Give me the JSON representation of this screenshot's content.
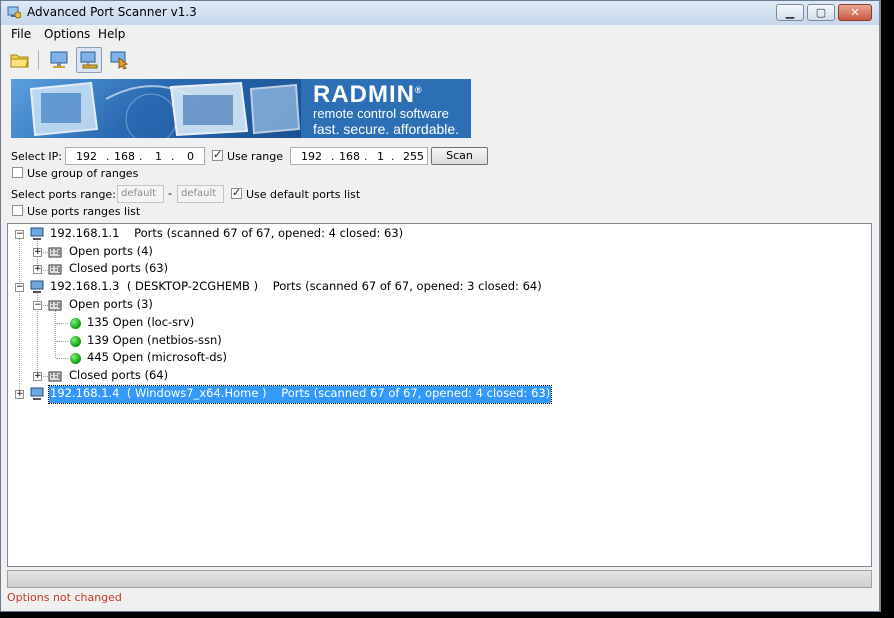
{
  "window": {
    "title": "Advanced Port Scanner v1.3"
  },
  "menu": {
    "items": [
      "File",
      "Options",
      "Help"
    ]
  },
  "banner": {
    "title": "RADMIN",
    "registered": "®",
    "line2": "remote control software",
    "line3": "fast. secure. affordable."
  },
  "ip_range": {
    "label": "Select IP:",
    "from": [
      "192",
      "168",
      "1",
      "0"
    ],
    "use_range_label": "Use range",
    "use_range_checked": true,
    "to": [
      "192",
      "168",
      "1",
      "255"
    ],
    "scan_label": "Scan"
  },
  "group": {
    "label": "Use group of ranges",
    "checked": false
  },
  "ports": {
    "label": "Select ports range:",
    "from_placeholder": "default",
    "separator": "-",
    "to_placeholder": "default",
    "use_default_label": "Use default ports list",
    "use_default_checked": true,
    "ranges_list_label": "Use ports ranges list",
    "ranges_list_checked": false
  },
  "tree": {
    "host1": {
      "ip": "192.168.1.1",
      "name": "",
      "summary": "Ports (scanned 67 of 67, opened: 4 closed: 63)",
      "open_label": "Open ports (4)",
      "closed_label": "Closed ports (63)"
    },
    "host2": {
      "ip": "192.168.1.3",
      "name": "( DESKTOP-2CGHEMB )",
      "summary": "Ports (scanned 67 of 67, opened: 3 closed: 64)",
      "open_label": "Open ports (3)",
      "open_ports": [
        "135 Open (loc-srv)",
        "139 Open (netbios-ssn)",
        "445 Open (microsoft-ds)"
      ],
      "closed_label": "Closed ports (64)"
    },
    "host3": {
      "ip": "192.168.1.4",
      "name": "( Windows7_x64.Home )",
      "summary": "Ports (scanned 67 of 67, opened: 4 closed: 63)"
    }
  },
  "progress": {
    "value": 0
  },
  "status": {
    "text": "Options not changed"
  },
  "colors": {
    "selection": "#3399ff",
    "status_text": "#c0392b",
    "open_port": "#10a010"
  }
}
